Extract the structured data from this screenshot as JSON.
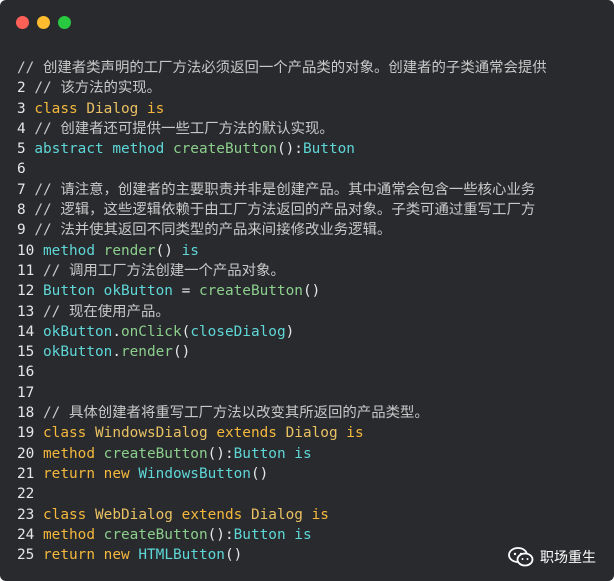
{
  "window": {
    "controls": [
      "close",
      "minimize",
      "zoom"
    ]
  },
  "code": {
    "lines": [
      {
        "n": "",
        "indent": 0,
        "parts": [
          {
            "c": "cm",
            "t": "// 创建者类声明的工厂方法必须返回一个产品类的对象。创建者的子类通常会提供"
          }
        ]
      },
      {
        "n": "2",
        "indent": 1,
        "parts": [
          {
            "c": "cm",
            "t": "// 该方法的实现。"
          }
        ]
      },
      {
        "n": "3",
        "indent": 1,
        "parts": [
          {
            "c": "kw",
            "t": "class"
          },
          {
            "c": "tx",
            "t": " "
          },
          {
            "c": "ty",
            "t": "Dialog"
          },
          {
            "c": "tx",
            "t": " "
          },
          {
            "c": "kw",
            "t": "is"
          }
        ]
      },
      {
        "n": "4",
        "indent": 1,
        "parts": [
          {
            "c": "cm",
            "t": "// 创建者还可提供一些工厂方法的默认实现。"
          }
        ]
      },
      {
        "n": "5",
        "indent": 1,
        "parts": [
          {
            "c": "id",
            "t": "abstract"
          },
          {
            "c": "tx",
            "t": " "
          },
          {
            "c": "id",
            "t": "method"
          },
          {
            "c": "tx",
            "t": " "
          },
          {
            "c": "fn",
            "t": "createButton"
          },
          {
            "c": "tx",
            "t": "():"
          },
          {
            "c": "ty2",
            "t": "Button"
          }
        ]
      },
      {
        "n": "6",
        "indent": 1,
        "parts": []
      },
      {
        "n": "7",
        "indent": 1,
        "parts": [
          {
            "c": "cm",
            "t": "// 请注意，创建者的主要职责并非是创建产品。其中通常会包含一些核心业务"
          }
        ]
      },
      {
        "n": "8",
        "indent": 1,
        "parts": [
          {
            "c": "cm",
            "t": "// 逻辑，这些逻辑依赖于由工厂方法返回的产品对象。子类可通过重写工厂方"
          }
        ]
      },
      {
        "n": "9",
        "indent": 1,
        "parts": [
          {
            "c": "cm",
            "t": "// 法并使其返回不同类型的产品来间接修改业务逻辑。"
          }
        ]
      },
      {
        "n": "10",
        "indent": 1,
        "parts": [
          {
            "c": "id",
            "t": "method"
          },
          {
            "c": "tx",
            "t": " "
          },
          {
            "c": "fn",
            "t": "render"
          },
          {
            "c": "tx",
            "t": "() "
          },
          {
            "c": "id",
            "t": "is"
          }
        ]
      },
      {
        "n": "11",
        "indent": 1,
        "parts": [
          {
            "c": "cm",
            "t": "// 调用工厂方法创建一个产品对象。"
          }
        ]
      },
      {
        "n": "12",
        "indent": 1,
        "parts": [
          {
            "c": "ty2",
            "t": "Button"
          },
          {
            "c": "tx",
            "t": " "
          },
          {
            "c": "id",
            "t": "okButton"
          },
          {
            "c": "tx",
            "t": " = "
          },
          {
            "c": "fn",
            "t": "createButton"
          },
          {
            "c": "tx",
            "t": "()"
          }
        ]
      },
      {
        "n": "13",
        "indent": 1,
        "parts": [
          {
            "c": "cm",
            "t": "// 现在使用产品。"
          }
        ]
      },
      {
        "n": "14",
        "indent": 1,
        "parts": [
          {
            "c": "id",
            "t": "okButton"
          },
          {
            "c": "tx",
            "t": "."
          },
          {
            "c": "fn",
            "t": "onClick"
          },
          {
            "c": "tx",
            "t": "("
          },
          {
            "c": "id",
            "t": "closeDialog"
          },
          {
            "c": "tx",
            "t": ")"
          }
        ]
      },
      {
        "n": "15",
        "indent": 1,
        "parts": [
          {
            "c": "id",
            "t": "okButton"
          },
          {
            "c": "tx",
            "t": "."
          },
          {
            "c": "fn",
            "t": "render"
          },
          {
            "c": "tx",
            "t": "()"
          }
        ]
      },
      {
        "n": "16",
        "indent": 1,
        "parts": []
      },
      {
        "n": "17",
        "indent": 1,
        "parts": []
      },
      {
        "n": "18",
        "indent": 1,
        "parts": [
          {
            "c": "cm",
            "t": "// 具体创建者将重写工厂方法以改变其所返回的产品类型。"
          }
        ]
      },
      {
        "n": "19",
        "indent": 1,
        "parts": [
          {
            "c": "kw",
            "t": "class"
          },
          {
            "c": "tx",
            "t": " "
          },
          {
            "c": "ty",
            "t": "WindowsDialog"
          },
          {
            "c": "tx",
            "t": " "
          },
          {
            "c": "kw",
            "t": "extends"
          },
          {
            "c": "tx",
            "t": " "
          },
          {
            "c": "ty",
            "t": "Dialog"
          },
          {
            "c": "tx",
            "t": " "
          },
          {
            "c": "kw",
            "t": "is"
          }
        ]
      },
      {
        "n": "20",
        "indent": 1,
        "parts": [
          {
            "c": "kw",
            "t": "method"
          },
          {
            "c": "tx",
            "t": " "
          },
          {
            "c": "fn",
            "t": "createButton"
          },
          {
            "c": "tx",
            "t": "():"
          },
          {
            "c": "ty2",
            "t": "Button"
          },
          {
            "c": "tx",
            "t": " "
          },
          {
            "c": "id",
            "t": "is"
          }
        ]
      },
      {
        "n": "21",
        "indent": 1,
        "parts": [
          {
            "c": "kw",
            "t": "return"
          },
          {
            "c": "tx",
            "t": " "
          },
          {
            "c": "kw",
            "t": "new"
          },
          {
            "c": "tx",
            "t": " "
          },
          {
            "c": "ty2",
            "t": "WindowsButton"
          },
          {
            "c": "tx",
            "t": "()"
          }
        ]
      },
      {
        "n": "22",
        "indent": 1,
        "parts": []
      },
      {
        "n": "23",
        "indent": 1,
        "parts": [
          {
            "c": "kw",
            "t": "class"
          },
          {
            "c": "tx",
            "t": " "
          },
          {
            "c": "ty",
            "t": "WebDialog"
          },
          {
            "c": "tx",
            "t": " "
          },
          {
            "c": "kw",
            "t": "extends"
          },
          {
            "c": "tx",
            "t": " "
          },
          {
            "c": "ty",
            "t": "Dialog"
          },
          {
            "c": "tx",
            "t": " "
          },
          {
            "c": "kw",
            "t": "is"
          }
        ]
      },
      {
        "n": "24",
        "indent": 1,
        "parts": [
          {
            "c": "kw",
            "t": "method"
          },
          {
            "c": "tx",
            "t": " "
          },
          {
            "c": "fn",
            "t": "createButton"
          },
          {
            "c": "tx",
            "t": "():"
          },
          {
            "c": "ty2",
            "t": "Button"
          },
          {
            "c": "tx",
            "t": " "
          },
          {
            "c": "id",
            "t": "is"
          }
        ]
      },
      {
        "n": "25",
        "indent": 1,
        "parts": [
          {
            "c": "kw",
            "t": "return"
          },
          {
            "c": "tx",
            "t": " "
          },
          {
            "c": "kw",
            "t": "new"
          },
          {
            "c": "tx",
            "t": " "
          },
          {
            "c": "ty2",
            "t": "HTMLButton"
          },
          {
            "c": "tx",
            "t": "()"
          }
        ]
      }
    ]
  },
  "watermark": {
    "label": "职场重生",
    "icon": "wechat-icon"
  },
  "colors": {
    "background": "#282a2e",
    "comment": "#c8c8c8",
    "keyword": "#f5b83c",
    "type": "#e9c062",
    "function": "#8ccf8c",
    "identifier": "#5fd7d7"
  }
}
